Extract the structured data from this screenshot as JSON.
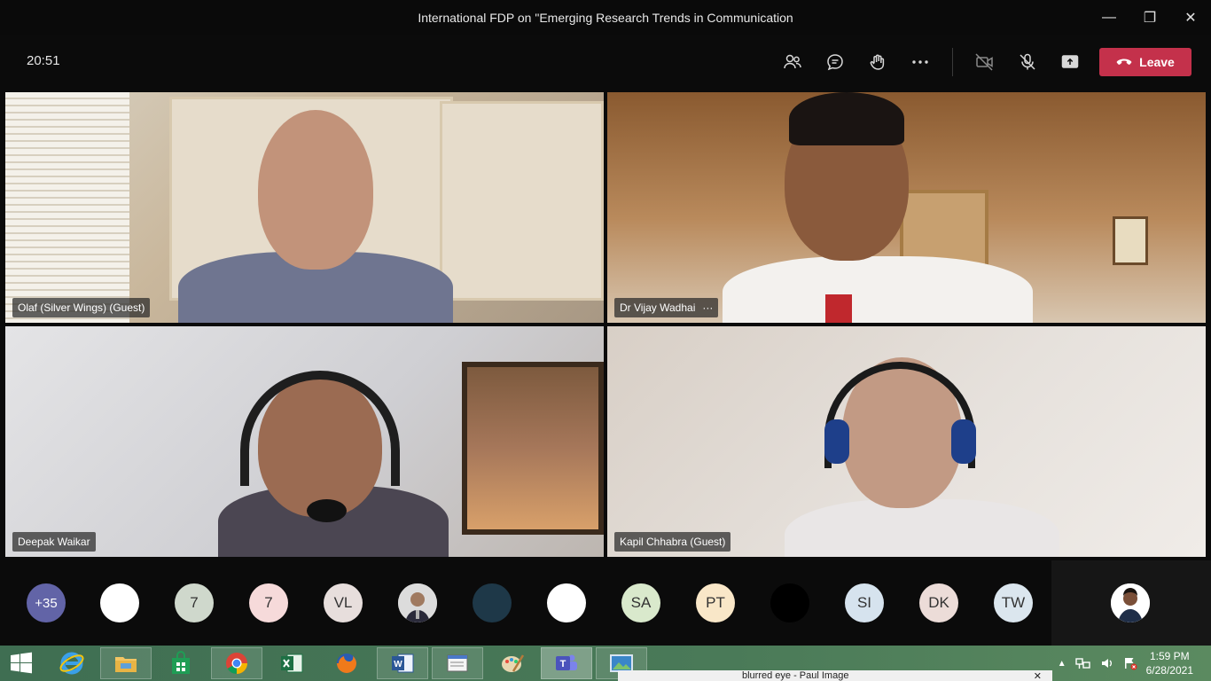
{
  "window": {
    "title": "International FDP on \"Emerging Research Trends in Communication",
    "minimize": "—",
    "restore": "❐",
    "close": "✕"
  },
  "toolbar": {
    "time": "20:51",
    "leave_label": "Leave"
  },
  "tiles": [
    {
      "name": "Olaf (Silver Wings) (Guest)"
    },
    {
      "name": "Dr Vijay Wadhai",
      "more": "···"
    },
    {
      "name": "Deepak Waikar"
    },
    {
      "name": "Kapil Chhabra (Guest)"
    }
  ],
  "participants": {
    "overflow": "+35",
    "avatars": [
      "",
      "7",
      "7",
      "VL",
      "",
      "",
      "",
      "SA",
      "PT",
      "",
      "SI",
      "DK",
      "TW"
    ]
  },
  "taskbar": {
    "time": "1:59 PM",
    "date": "6/28/2021",
    "popup_text": "blurred eye - Paul Image"
  },
  "colors": {
    "leave": "#c4314b",
    "overflow_avatar": "#6264a7"
  }
}
